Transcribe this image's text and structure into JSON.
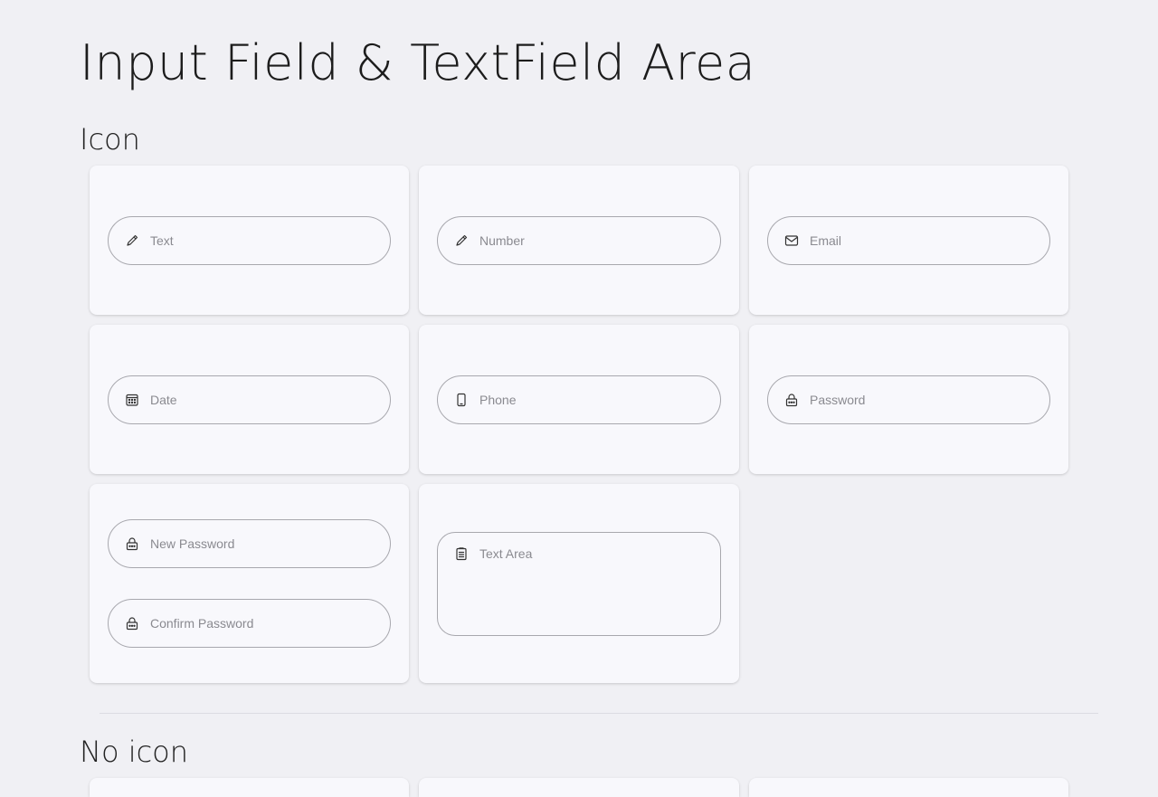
{
  "page_title": "Input Field & TextField Area",
  "sections": {
    "icon": {
      "title": "Icon",
      "fields": {
        "text": {
          "placeholder": "Text",
          "icon": "pencil-icon"
        },
        "number": {
          "placeholder": "Number",
          "icon": "pencil-icon"
        },
        "email": {
          "placeholder": "Email",
          "icon": "envelope-icon"
        },
        "date": {
          "placeholder": "Date",
          "icon": "calendar-icon"
        },
        "phone": {
          "placeholder": "Phone",
          "icon": "phone-icon"
        },
        "password": {
          "placeholder": "Password",
          "icon": "lock-icon"
        },
        "new_password": {
          "placeholder": "New Password",
          "icon": "lock-icon"
        },
        "confirm_password": {
          "placeholder": "Confirm Password",
          "icon": "lock-icon"
        },
        "text_area": {
          "placeholder": "Text Area",
          "icon": "clipboard-icon"
        }
      }
    },
    "no_icon": {
      "title": "No icon"
    }
  },
  "colors": {
    "background": "#f0f0f4",
    "card": "#f8f8fc",
    "field_border": "#a8a8ae",
    "placeholder": "#8a8a90",
    "icon": "#333333"
  }
}
